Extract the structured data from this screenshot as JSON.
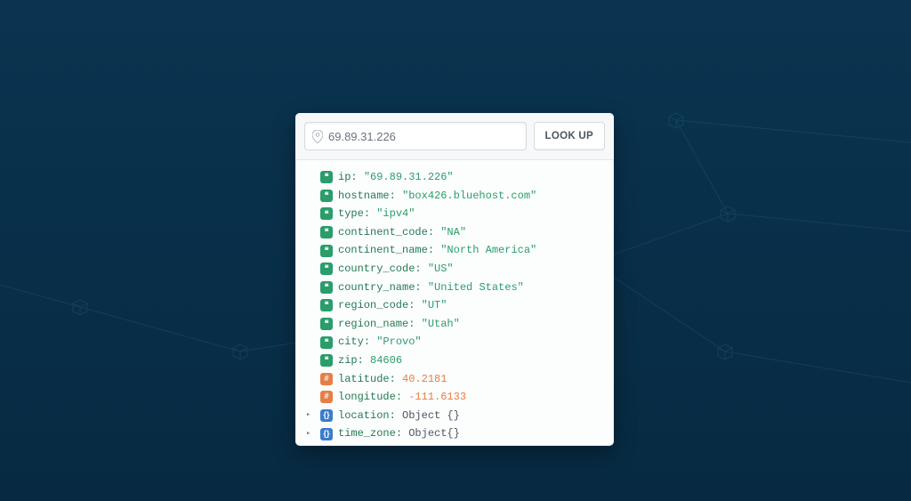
{
  "search": {
    "value": "69.89.31.226",
    "lookup_label": "LOOK UP"
  },
  "result": {
    "ip": {
      "key": "ip",
      "type": "string",
      "value": "\"69.89.31.226\""
    },
    "hostname": {
      "key": "hostname",
      "type": "string",
      "value": "\"box426.bluehost.com\""
    },
    "iptype": {
      "key": "type",
      "type": "string",
      "value": "\"ipv4\""
    },
    "continent_code": {
      "key": "continent_code",
      "type": "string",
      "value": "\"NA\""
    },
    "continent_name": {
      "key": "continent_name",
      "type": "string",
      "value": "\"North America\""
    },
    "country_code": {
      "key": "country_code",
      "type": "string",
      "value": "\"US\""
    },
    "country_name": {
      "key": "country_name",
      "type": "string",
      "value": "\"United States\""
    },
    "region_code": {
      "key": "region_code",
      "type": "string",
      "value": "\"UT\""
    },
    "region_name": {
      "key": "region_name",
      "type": "string",
      "value": "\"Utah\""
    },
    "city": {
      "key": "city",
      "type": "string",
      "value": "\"Provo\""
    },
    "zip": {
      "key": "zip",
      "type": "string",
      "value": "84606"
    },
    "latitude": {
      "key": "latitude",
      "type": "number",
      "value": "40.2181"
    },
    "longitude": {
      "key": "longitude",
      "type": "number",
      "value": "-111.6133"
    },
    "location": {
      "key": "location",
      "type": "object",
      "value": "Object {}"
    },
    "time_zone": {
      "key": "time_zone",
      "type": "object",
      "value": "Object{}"
    }
  },
  "badge_glyph": {
    "string": "❝",
    "number": "#",
    "object": "{}"
  }
}
